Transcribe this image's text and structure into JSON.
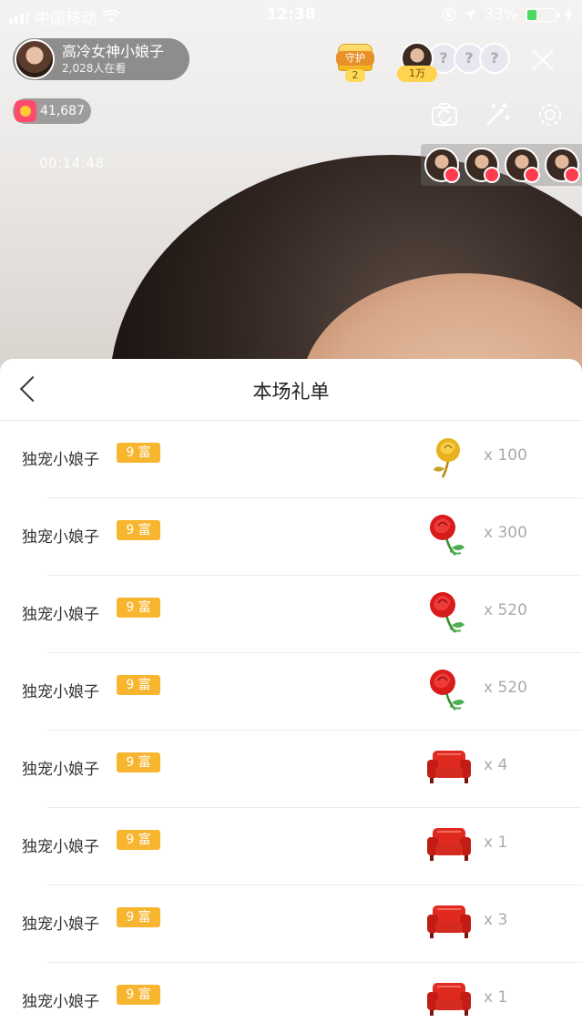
{
  "status_bar": {
    "carrier": "中国移动",
    "time": "12:38",
    "battery": "33%",
    "battery_level": 0.33
  },
  "host": {
    "name": "高冷女神小娘子",
    "viewers": "2,028人在看"
  },
  "guard": {
    "label": "守护",
    "count": "2"
  },
  "ranking": {
    "top_value": "1万",
    "placeholders": [
      "?",
      "?",
      "?"
    ]
  },
  "coins": "41,687",
  "timer": "00:14:48",
  "gift_list": {
    "title": "本场礼单",
    "rows": [
      {
        "user": "独宠小娘子",
        "level": "9 富",
        "gift": "golden-rose-icon",
        "qty": "x 100"
      },
      {
        "user": "独宠小娘子",
        "level": "9 富",
        "gift": "red-rose-icon",
        "qty": "x 300"
      },
      {
        "user": "独宠小娘子",
        "level": "9 富",
        "gift": "red-rose-icon",
        "qty": "x 520"
      },
      {
        "user": "独宠小娘子",
        "level": "9 富",
        "gift": "red-rose-icon",
        "qty": "x 520"
      },
      {
        "user": "独宠小娘子",
        "level": "9 富",
        "gift": "red-sofa-icon",
        "qty": "x 4"
      },
      {
        "user": "独宠小娘子",
        "level": "9 富",
        "gift": "red-sofa-icon",
        "qty": "x 1"
      },
      {
        "user": "独宠小娘子",
        "level": "9 富",
        "gift": "red-sofa-icon",
        "qty": "x 3"
      },
      {
        "user": "独宠小娘子",
        "level": "9 富",
        "gift": "red-sofa-icon",
        "qty": "x 1"
      }
    ]
  },
  "colors": {
    "level_badge": "#f7b530",
    "rose_red": "#d81b1b",
    "gold_rose": "#e9b21d",
    "sofa_red": "#d42a1f"
  }
}
